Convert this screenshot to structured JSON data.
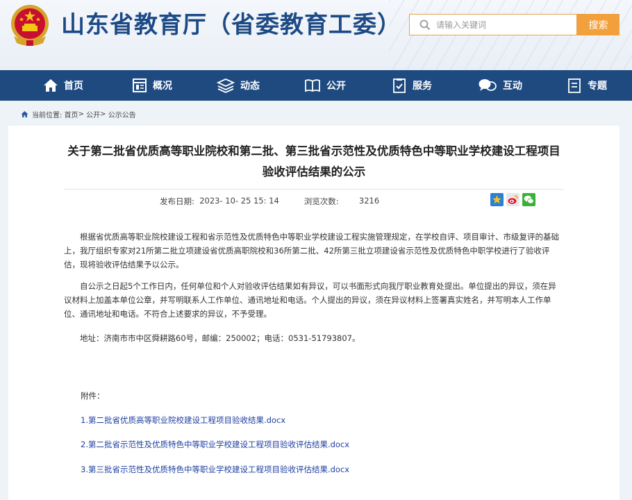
{
  "header": {
    "site_title": "山东省教育厅（省委教育工委）",
    "search_placeholder": "请输入关键词",
    "search_button": "搜索"
  },
  "nav": {
    "items": [
      {
        "label": "首页",
        "icon": "home-icon"
      },
      {
        "label": "概况",
        "icon": "overview-icon"
      },
      {
        "label": "动态",
        "icon": "news-icon"
      },
      {
        "label": "公开",
        "icon": "book-icon"
      },
      {
        "label": "服务",
        "icon": "service-icon"
      },
      {
        "label": "互动",
        "icon": "chat-icon"
      },
      {
        "label": "专题",
        "icon": "topic-icon"
      }
    ]
  },
  "breadcrumb": {
    "prefix": "当前位置:",
    "items": [
      "首页",
      "公开",
      "公示公告"
    ],
    "separator": ">"
  },
  "article": {
    "title": "关于第二批省优质高等职业院校和第二批、第三批省示范性及优质特色中等职业学校建设工程项目验收评估结果的公示",
    "publish_label": "发布日期:",
    "publish_date": "2023- 10- 25 15: 14",
    "views_label": "浏览次数:",
    "views": "3216",
    "share_icons": [
      "qzone-icon",
      "weibo-icon",
      "wechat-icon"
    ],
    "paragraphs": [
      "根据省优质高等职业院校建设工程和省示范性及优质特色中等职业学校建设工程实施管理规定，在学校自评、项目审计、市级复评的基础上，我厅组织专家对21所第二批立项建设省优质高职院校和36所第二批、42所第三批立项建设省示范性及优质特色中职学校进行了验收评估，现将验收评估结果予以公示。",
      "自公示之日起5个工作日内，任何单位和个人对验收评估结果如有异议，可以书面形式向我厅职业教育处提出。单位提出的异议，须在异议材料上加盖本单位公章，并写明联系人工作单位、通讯地址和电话。个人提出的异议，须在异议材料上签署真实姓名，并写明本人工作单位、通讯地址和电话。不符合上述要求的异议，不予受理。",
      "地址：济南市市中区舜耕路60号，邮编：250002；电话：0531-51793807。"
    ],
    "attachments_label": "附件：",
    "attachments": [
      "1.第二批省优质高等职业院校建设工程项目验收结果.docx",
      "2.第二批省示范性及优质特色中等职业学校建设工程项目验收评估结果.docx",
      "3.第三批省示范性及优质特色中等职业学校建设工程项目验收评估结果.docx"
    ]
  },
  "colors": {
    "nav_bg": "#1e4a80",
    "title_blue": "#1d4a86",
    "search_orange": "#f2a03b",
    "link_blue": "#1f3fa0"
  }
}
